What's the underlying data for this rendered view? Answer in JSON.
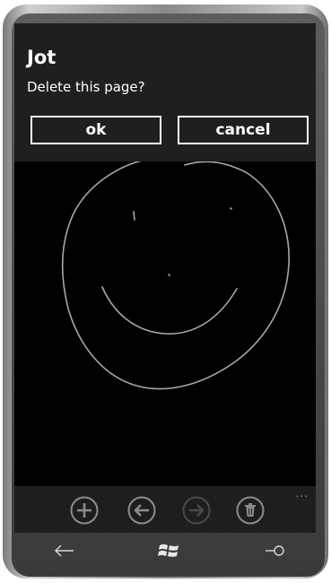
{
  "dialog": {
    "title": "Jot",
    "message": "Delete this page?",
    "ok_label": "ok",
    "cancel_label": "cancel"
  },
  "appbar": {
    "buttons": [
      {
        "icon": "add-icon",
        "enabled": true
      },
      {
        "icon": "back-arrow-icon",
        "enabled": true
      },
      {
        "icon": "forward-arrow-icon",
        "enabled": false
      },
      {
        "icon": "trash-icon",
        "enabled": true
      }
    ],
    "more_label": "..."
  },
  "navbar": {
    "back": "back-icon",
    "start": "windows-logo-icon",
    "search": "search-icon"
  },
  "colors": {
    "dialog_bg": "#1f1f1f",
    "appbar_bg": "#1e1e1e",
    "ink": "#a8a8a8",
    "disabled": "#4a4a4a"
  }
}
